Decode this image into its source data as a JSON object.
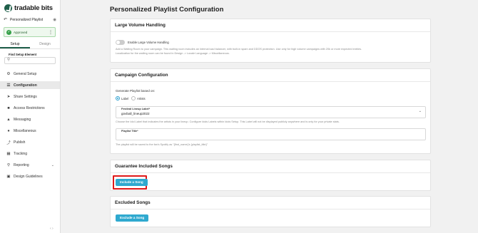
{
  "brand": {
    "name": "tradable bits"
  },
  "sidebar": {
    "playlist_name": "Personalized Playlist",
    "status": "Approved",
    "tabs": [
      "Setup",
      "Design"
    ],
    "find_label": "Find Setup Element",
    "items": [
      {
        "label": "General Setup",
        "icon": "gear-icon"
      },
      {
        "label": "Configuration",
        "icon": "sliders-icon"
      },
      {
        "label": "Share Settings",
        "icon": "share-icon"
      },
      {
        "label": "Access Restrictions",
        "icon": "lock-icon"
      },
      {
        "label": "Messaging",
        "icon": "bell-icon"
      },
      {
        "label": "Miscellaneous",
        "icon": "globe-icon"
      },
      {
        "label": "Publish",
        "icon": "publish-icon"
      },
      {
        "label": "Tracking",
        "icon": "tracking-icon"
      },
      {
        "label": "Reporting",
        "icon": "magnify-chart-icon"
      },
      {
        "label": "Design Guidelines",
        "icon": "image-icon"
      }
    ],
    "active_item": "Configuration"
  },
  "main": {
    "title": "Personalized Playlist Configuration",
    "large_volume": {
      "title": "Large Volume Handling",
      "toggle_label": "Enable Large Volume Handling",
      "toggle_on": false,
      "desc_line1": "Add a Waiting Room to your campaign. This waiting room includes an internal load balancer, with built-in spam and DDOS protection. Use only for high volume campaigns with 20k or more expected entries.",
      "desc_line2": "Localization for the waiting room can be found in Design -> Locale Language -> Miscellaneous."
    },
    "campaign": {
      "title": "Campaign Configuration",
      "generate_label": "Generate Playlist based on:",
      "options": [
        "Label",
        "Artists"
      ],
      "selected_option": "Label",
      "festival_label": "Festival Lineup Label*",
      "festival_value": "govball_lineup2022",
      "festival_help": "Choose the Idol Label that indicates the artists in your lineup. Configure Idols Labels within Idols Setup. This Label will not be displayed publicly anywhere and is only for your private stats.",
      "playlist_title_label": "Playlist Title*",
      "playlist_title_value": "",
      "playlist_title_help": "The playlist will be saved to the fan's Spotify as \"{first_name}'s {playlist_title}\""
    },
    "guarantee": {
      "title": "Guarantee Included Songs",
      "button": "Include a Song"
    },
    "excluded": {
      "title": "Excluded Songs",
      "button": "Exclude a Song"
    }
  },
  "colors": {
    "accent": "#2fa9cf",
    "brand": "#1f5f4a",
    "highlight": "#e01919",
    "approved": "#36a04a"
  }
}
